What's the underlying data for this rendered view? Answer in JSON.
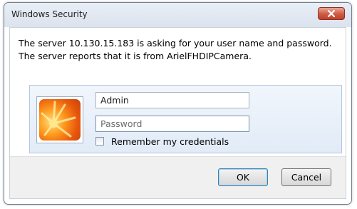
{
  "window": {
    "title": "Windows Security",
    "close_icon": "close-x-icon",
    "close_color": "#c9432d"
  },
  "message": {
    "text": "The server 10.130.15.183 is asking for your user name and password. The server reports that it is from ArielFHDIPCamera."
  },
  "credentials": {
    "user_icon": "user-picture-flower-icon",
    "username_value": "Admin",
    "password_placeholder": "Password",
    "remember_label": "Remember my credentials",
    "remember_checked": false
  },
  "buttons": {
    "ok_label": "OK",
    "cancel_label": "Cancel"
  }
}
